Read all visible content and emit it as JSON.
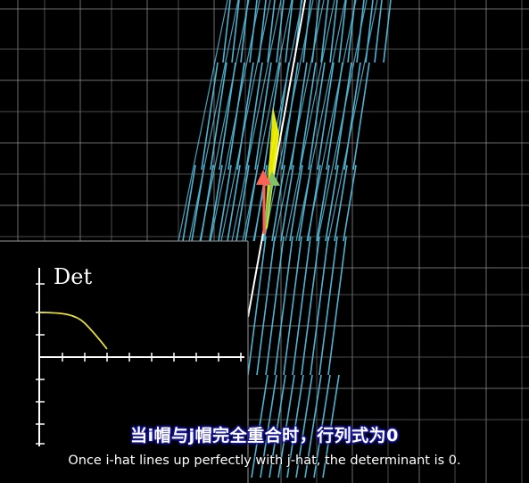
{
  "plot": {
    "label": "Det",
    "curve_color": "#e8e03a"
  },
  "colors": {
    "grid": "#6b6b6b",
    "grid_bright": "#9a9a9a",
    "transformed_lines": "#4fb3d0",
    "i_hat": "#83c167",
    "j_hat": "#fc6255",
    "area": "#ffff00",
    "span_line": "#ffffff"
  },
  "subtitles": {
    "chinese": "当i帽与j帽完全重合时，行列式为0",
    "english": "Once i-hat lines up perfectly with j-hat, the determinant is 0."
  }
}
